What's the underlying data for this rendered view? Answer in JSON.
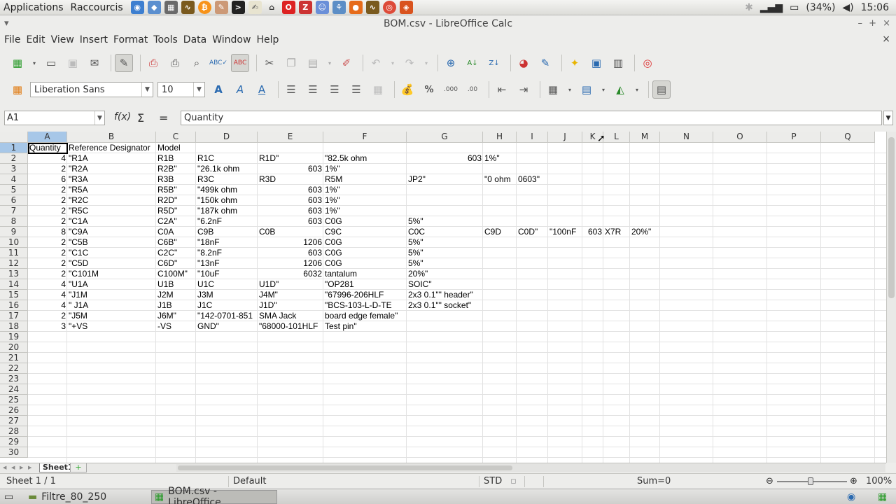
{
  "topbar": {
    "applications": "Applications",
    "shortcuts": "Raccourcis",
    "battery": "(34%)",
    "clock": "15:06"
  },
  "window": {
    "title": "BOM.csv - LibreOffice Calc"
  },
  "menu": [
    "File",
    "Edit",
    "View",
    "Insert",
    "Format",
    "Tools",
    "Data",
    "Window",
    "Help"
  ],
  "format": {
    "font_name": "Liberation Sans",
    "font_size": "10"
  },
  "formula": {
    "cell_ref": "A1",
    "content": "Quantity"
  },
  "columns": [
    "A",
    "B",
    "C",
    "D",
    "E",
    "F",
    "G",
    "H",
    "I",
    "J",
    "K",
    "L",
    "M",
    "N",
    "O",
    "P",
    "Q"
  ],
  "rows": [
    "1",
    "2",
    "3",
    "4",
    "5",
    "6",
    "7",
    "8",
    "9",
    "10",
    "11",
    "12",
    "13",
    "14",
    "15",
    "16",
    "17",
    "18",
    "19",
    "20",
    "21",
    "22",
    "23",
    "24",
    "25",
    "26",
    "27",
    "28",
    "29",
    "30"
  ],
  "cells": [
    [
      "Quantity",
      "Reference Designator",
      "Model",
      "",
      "",
      "",
      "",
      "",
      "",
      "",
      "",
      "",
      ""
    ],
    [
      "4",
      "\"R1A",
      "R1B",
      "R1C",
      "R1D\"",
      "\"82.5k ohm",
      "603",
      "1%\"",
      "",
      "",
      "",
      "",
      ""
    ],
    [
      "2",
      "\"R2A",
      "R2B\"",
      "\"26.1k ohm",
      "603",
      "1%\"",
      "",
      "",
      "",
      "",
      "",
      "",
      ""
    ],
    [
      "6",
      "\"R3A",
      "R3B",
      "R3C",
      "R3D",
      "R5M",
      "JP2\"",
      "\"0 ohm",
      "0603\"",
      "",
      "",
      "",
      ""
    ],
    [
      "2",
      "\"R5A",
      "R5B\"",
      "\"499k ohm",
      "603",
      "1%\"",
      "",
      "",
      "",
      "",
      "",
      "",
      ""
    ],
    [
      "2",
      "\"R2C",
      "R2D\"",
      "\"150k ohm",
      "603",
      "1%\"",
      "",
      "",
      "",
      "",
      "",
      "",
      ""
    ],
    [
      "2",
      "\"R5C",
      "R5D\"",
      "\"187k ohm",
      "603",
      "1%\"",
      "",
      "",
      "",
      "",
      "",
      "",
      ""
    ],
    [
      "2",
      "\"C1A",
      "C2A\"",
      "\"6.2nF",
      "603",
      "C0G",
      "5%\"",
      "",
      "",
      "",
      "",
      "",
      ""
    ],
    [
      "8",
      "\"C9A",
      "C0A",
      "C9B",
      "C0B",
      "C9C",
      "C0C",
      "C9D",
      "C0D\"",
      "\"100nF",
      "603",
      "X7R",
      "20%\""
    ],
    [
      "2",
      "\"C5B",
      "C6B\"",
      "\"18nF",
      "1206",
      "C0G",
      "5%\"",
      "",
      "",
      "",
      "",
      "",
      ""
    ],
    [
      "2",
      "\"C1C",
      "C2C\"",
      "\"8.2nF",
      "603",
      "C0G",
      "5%\"",
      "",
      "",
      "",
      "",
      "",
      ""
    ],
    [
      "2",
      "\"C5D",
      "C6D\"",
      "\"13nF",
      "1206",
      "C0G",
      "5%\"",
      "",
      "",
      "",
      "",
      "",
      ""
    ],
    [
      "2",
      "\"C101M",
      "C100M\"",
      "\"10uF",
      "6032",
      "tantalum",
      "20%\"",
      "",
      "",
      "",
      "",
      "",
      ""
    ],
    [
      "4",
      "\"U1A",
      "U1B",
      "U1C",
      "U1D\"",
      "\"OP281",
      "SOIC\"",
      "",
      "",
      "",
      "",
      "",
      ""
    ],
    [
      "4",
      "\"J1M",
      "J2M",
      "J3M",
      "J4M\"",
      "\"67996-206HLF",
      "2x3 0.1\"\" header\"",
      "",
      "",
      "",
      "",
      "",
      ""
    ],
    [
      "4",
      "\" J1A",
      "J1B",
      "J1C",
      "J1D\"",
      "\"BCS-103-L-D-TE",
      "2x3 0.1\"\" socket\"",
      "",
      "",
      "",
      "",
      "",
      ""
    ],
    [
      "2",
      "\"J5M",
      "J6M\"",
      "\"142-0701-851",
      "SMA Jack",
      "board edge female\"",
      "",
      "",
      "",
      "",
      "",
      "",
      ""
    ],
    [
      "3",
      "\"+VS",
      "-VS",
      "GND\"",
      "\"68000-101HLF",
      "Test pin\"",
      "",
      "",
      "",
      "",
      "",
      "",
      ""
    ]
  ],
  "sheet_tab": "Sheet1",
  "status": {
    "sheet": "Sheet 1 / 1",
    "style": "Default",
    "mode": "STD",
    "sum": "Sum=0",
    "zoom": "100%"
  },
  "taskbar": {
    "task1": "Filtre_80_250",
    "task2": "BOM.csv - LibreOffice..."
  }
}
